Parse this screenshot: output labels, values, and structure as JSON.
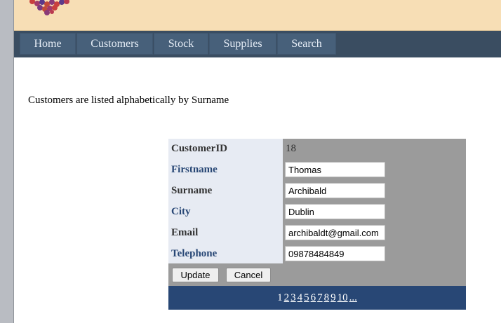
{
  "nav": {
    "items": [
      {
        "label": "Home"
      },
      {
        "label": "Customers"
      },
      {
        "label": "Stock"
      },
      {
        "label": "Supplies"
      },
      {
        "label": "Search"
      }
    ]
  },
  "page": {
    "intro": "Customers are listed alphabetically by Surname"
  },
  "customer": {
    "labels": {
      "id": "CustomerID",
      "firstname": "Firstname",
      "surname": "Surname",
      "city": "City",
      "email": "Email",
      "telephone": "Telephone"
    },
    "id_value": "18",
    "firstname": "Thomas",
    "surname": "Archibald",
    "city": "Dublin",
    "email": "archibaldt@gmail.com",
    "telephone": "09878484849"
  },
  "buttons": {
    "update": "Update",
    "cancel": "Cancel"
  },
  "pager": {
    "current": "1",
    "pages": [
      "2",
      "3",
      "4",
      "5",
      "6",
      "7",
      "8",
      "9",
      "10"
    ],
    "more": "..."
  },
  "colors": {
    "header": "#f7deb5",
    "nav": "#3a4d61",
    "label_alt": "#284775",
    "pager": "#284775"
  }
}
